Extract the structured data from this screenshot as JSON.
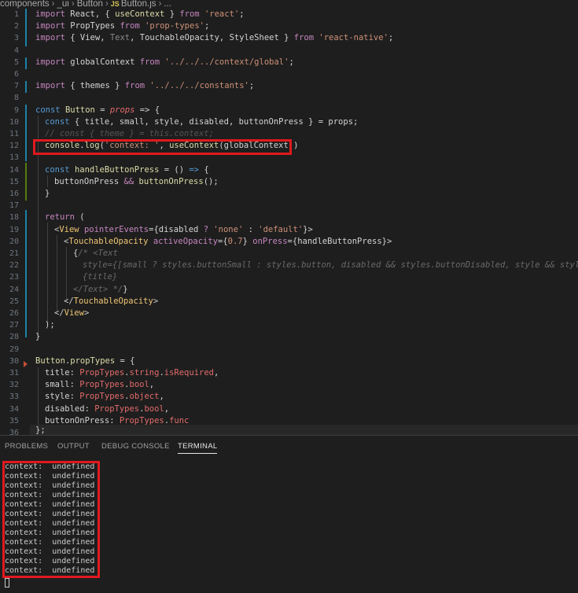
{
  "breadcrumb": {
    "items": [
      "components",
      "_ui",
      "Button",
      "Button.js",
      "..."
    ],
    "file_icon": "JS",
    "separator": ">"
  },
  "editor": {
    "line_numbers": [
      "1",
      "2",
      "3",
      "4",
      "5",
      "6",
      "7",
      "8",
      "9",
      "10",
      "11",
      "12",
      "13",
      "14",
      "15",
      "16",
      "17",
      "18",
      "19",
      "20",
      "21",
      "22",
      "23",
      "24",
      "25",
      "26",
      "27",
      "28",
      "29",
      "30",
      "31",
      "32",
      "33",
      "34",
      "35",
      "36"
    ],
    "code": {
      "l1": [
        "import",
        " React, { ",
        "useContext",
        " } ",
        "from",
        " ",
        "'react'",
        ";"
      ],
      "l2": [
        "import",
        " PropTypes ",
        "from",
        " ",
        "'prop-types'",
        ";"
      ],
      "l3": [
        "import",
        " { View, ",
        "Text",
        ", TouchableOpacity, StyleSheet } ",
        "from",
        " ",
        "'react-native'",
        ";"
      ],
      "l5": [
        "import",
        " globalContext ",
        "from",
        " ",
        "'../../../context/global'",
        ";"
      ],
      "l7": [
        "import",
        " { themes } ",
        "from",
        " ",
        "'../../../constants'",
        ";"
      ],
      "l9": [
        "const",
        " ",
        "Button",
        " = ",
        "props",
        " => {"
      ],
      "l10": [
        "const",
        " { ",
        "title",
        ", ",
        "small",
        ", ",
        "style",
        ", ",
        "disabled",
        ", ",
        "buttonOnPress",
        " } = props;"
      ],
      "l11": [
        "// const { theme } = this.context;"
      ],
      "l12": [
        "console",
        ".",
        "log",
        "(",
        "'context: '",
        ", ",
        "useContext",
        "(globalContext))"
      ],
      "l14": [
        "const",
        " ",
        "handleButtonPress",
        " = () ",
        "=>",
        " {"
      ],
      "l15": [
        "buttonOnPress",
        " ",
        "&&",
        " ",
        "buttonOnPress",
        "();"
      ],
      "l16": [
        "}"
      ],
      "l19": [
        "return",
        " ("
      ],
      "l20": [
        "<",
        "View",
        " ",
        "pointerEvents",
        "={disabled ",
        "?",
        " ",
        "'none'",
        " : ",
        "'default'",
        "}>"
      ],
      "l21": [
        "<",
        "TouchableOpacity",
        " ",
        "activeOpacity",
        "={",
        "0.7",
        "} ",
        "onPress",
        "={handleButtonPress}>"
      ],
      "l22": [
        "{",
        "/* <Text"
      ],
      "l23": [
        "style={[small ? styles.buttonSmall : styles.button, disabled && styles.buttonDisabled, style && style]}>"
      ],
      "l24": [
        "{title}"
      ],
      "l25": [
        "</Text> */",
        "}"
      ],
      "l26": [
        "</",
        "TouchableOpacity",
        ">"
      ],
      "l27": [
        "</",
        "View",
        ">"
      ],
      "l28": [
        ");"
      ],
      "l29": [
        "}"
      ],
      "l31": [
        "Button",
        ".",
        "propTypes",
        " = {"
      ],
      "l32": [
        "title",
        ": ",
        "PropTypes",
        ".",
        "string",
        ".",
        "isRequired",
        ","
      ],
      "l33": [
        "small",
        ": ",
        "PropTypes",
        ".",
        "bool",
        ","
      ],
      "l34": [
        "style",
        ": ",
        "PropTypes",
        ".",
        "object",
        ","
      ],
      "l35": [
        "disabled",
        ": ",
        "PropTypes",
        ".",
        "bool",
        ","
      ],
      "l36": [
        "buttonOnPress",
        ": ",
        "PropTypes",
        ".",
        "func"
      ],
      "l37": [
        "};"
      ]
    }
  },
  "panel": {
    "tabs": [
      "PROBLEMS",
      "OUTPUT",
      "DEBUG CONSOLE",
      "TERMINAL"
    ],
    "active_tab": "TERMINAL",
    "terminal_lines": [
      "context:  undefined",
      "context:  undefined",
      "context:  undefined",
      "context:  undefined",
      "context:  undefined",
      "context:  undefined",
      "context:  undefined",
      "context:  undefined",
      "context:  undefined",
      "context:  undefined",
      "context:  undefined",
      "context:  undefined"
    ]
  },
  "colors": {
    "highlight_box": "#e0191e",
    "keyword": "#c586c0",
    "string": "#ce9178",
    "function": "#dcdcaa",
    "background": "#1e1e1e"
  }
}
